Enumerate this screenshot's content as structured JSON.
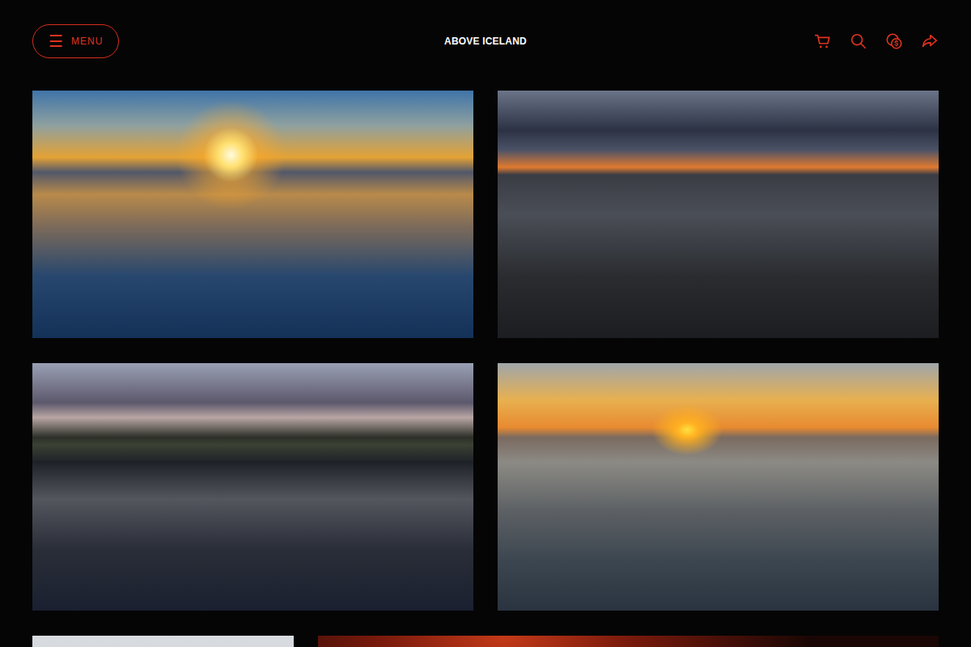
{
  "header": {
    "menu": {
      "icon": "☰",
      "label": "MENU"
    },
    "title": "ABOVE ICELAND"
  }
}
